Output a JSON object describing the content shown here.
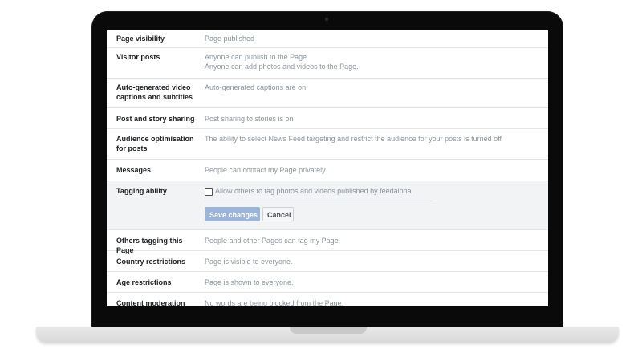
{
  "settings": {
    "rows": [
      {
        "label": "Page visibility",
        "value": [
          "Page published"
        ]
      },
      {
        "label": "Visitor posts",
        "value": [
          "Anyone can publish to the Page.",
          "Anyone can add photos and videos to the Page."
        ]
      },
      {
        "label": "Auto-generated video captions and subtitles",
        "value": [
          "Auto-generated captions are on"
        ]
      },
      {
        "label": "Post and story sharing",
        "value": [
          "Post sharing to stories is on"
        ]
      },
      {
        "label": "Audience optimisation for posts",
        "value": [
          "The ability to select News Feed targeting and restrict the audience for your posts is turned off"
        ]
      },
      {
        "label": "Messages",
        "value": [
          "People can contact my Page privately."
        ]
      },
      {
        "label": "Tagging ability",
        "checkbox_label": "Allow others to tag photos and videos published by feedalpha",
        "save_label": "Save changes",
        "cancel_label": "Cancel"
      },
      {
        "label": "Others tagging this Page",
        "value": [
          "People and other Pages can tag my Page."
        ]
      },
      {
        "label": "Country restrictions",
        "value": [
          "Page is visible to everyone."
        ]
      },
      {
        "label": "Age restrictions",
        "value": [
          "Page is shown to everyone."
        ]
      },
      {
        "label": "Content moderation",
        "value": [
          "No words are being blocked from the Page."
        ]
      }
    ]
  }
}
